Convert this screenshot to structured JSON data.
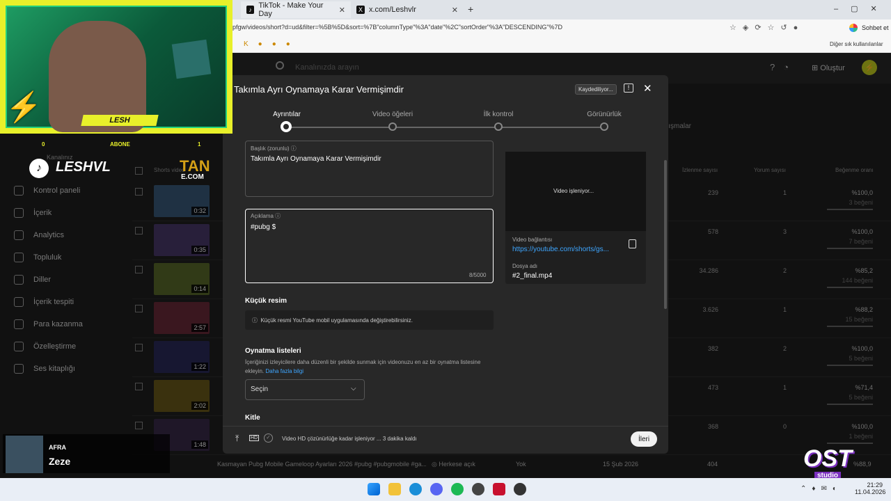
{
  "browser": {
    "tabs": [
      {
        "label": "TikTok - Make Your Day"
      },
      {
        "label": "x.com/Leshvlr"
      }
    ],
    "url": "pfgw/videos/short?d=ud&filter=%5B%5D&sort=%7B\"columnType\"%3A\"date\"%2C\"sortOrder\"%3A\"DESCENDING\"%7D",
    "chat_label": "Sohbet et",
    "bookmarks_other": "Diğer sık kullanılanlar"
  },
  "studio": {
    "search_placeholder": "Kanalınızda arayın",
    "create_label": "Oluştur",
    "channel_label": "Kanalınız",
    "nav": [
      "Kontrol paneli",
      "İçerik",
      "Analytics",
      "Topluluk",
      "Diller",
      "İçerik tespiti",
      "Para kazanma",
      "Özelleştirme",
      "Ses kitaplığı"
    ],
    "tab_partial": "lışmalar",
    "columns": {
      "shorts": "Shorts video",
      "views": "İzlenme sayısı",
      "comments": "Yorum sayısı",
      "likes": "Beğenme oranı"
    },
    "rows": [
      {
        "dur": "0:32",
        "views": "239",
        "comments": "1",
        "ratio": "%100,0",
        "likes": "3 beğeni"
      },
      {
        "dur": "0:35",
        "views": "578",
        "comments": "3",
        "ratio": "%100,0",
        "likes": "7 beğeni"
      },
      {
        "dur": "0:14",
        "views": "34.286",
        "comments": "2",
        "ratio": "%85,2",
        "likes": "144 beğeni"
      },
      {
        "dur": "2:57",
        "views": "3.626",
        "comments": "1",
        "ratio": "%88,2",
        "likes": "15 beğeni"
      },
      {
        "dur": "1:22",
        "views": "382",
        "comments": "2",
        "ratio": "%100,0",
        "likes": "5 beğeni"
      },
      {
        "dur": "2:02",
        "views": "473",
        "comments": "1",
        "ratio": "%71,4",
        "likes": "5 beğeni"
      },
      {
        "dur": "1:48",
        "views": "368",
        "comments": "0",
        "ratio": "%100,0",
        "likes": "1 beğeni"
      }
    ],
    "last_row": {
      "title": "Kasmayan Pubg Mobile Gameloop Ayarları 2026 #pubg #pubgmobile #ga...",
      "visibility": "Herkese açık",
      "restriction": "Yok",
      "date": "15 Şub 2026",
      "views": "404",
      "ratio": "%88,9"
    }
  },
  "modal": {
    "title": "Takımla Ayrı Oynamaya Karar Vermişimdir",
    "saving": "Kaydediliyor...",
    "steps": [
      "Ayrıntılar",
      "Video öğeleri",
      "İlk kontrol",
      "Görünürlük"
    ],
    "title_label": "Başlık (zorunlu)",
    "title_value": "Takımla Ayrı Oynamaya Karar Vermişimdir",
    "desc_label": "Açıklama",
    "desc_value": "#pubg  $",
    "desc_count": "8/5000",
    "processing": "Video işleniyor...",
    "link_label": "Video bağlantısı",
    "link_value": "https://youtube.com/shorts/gs...",
    "file_label": "Dosya adı",
    "file_value": "#2_final.mp4",
    "thumb_title": "Küçük resim",
    "thumb_info": "Küçük resmi YouTube mobil uygulamasında değiştirebilirsiniz.",
    "playlist_title": "Oynatma listeleri",
    "playlist_desc": "İçeriğinizi izleyicilere daha düzenli bir şekilde sunmak için videonuzu en az bir oynatma listesine ekleyin.",
    "playlist_link": "Daha fazla bilgi",
    "select_label": "Seçin",
    "audience_title": "Kitle",
    "footer_status": "Video HD çözünürlüğe kadar işleniyor ... 3 dakika kaldı",
    "hd_label": "HD",
    "next_label": "İleri"
  },
  "overlay": {
    "cam_name": "LESH",
    "follow_count": "0",
    "abone_label": "ABONE",
    "abone_count": "1",
    "tiktok_handle": "LESHVL",
    "tan_logo": "TAN",
    "tan_sub": "E.COM",
    "music_artist": "AFRA",
    "music_title": "Zeze",
    "ost_logo": "OST",
    "ost_sub": "studio"
  },
  "taskbar": {
    "time": "21:29",
    "date": "11.04.2026"
  }
}
